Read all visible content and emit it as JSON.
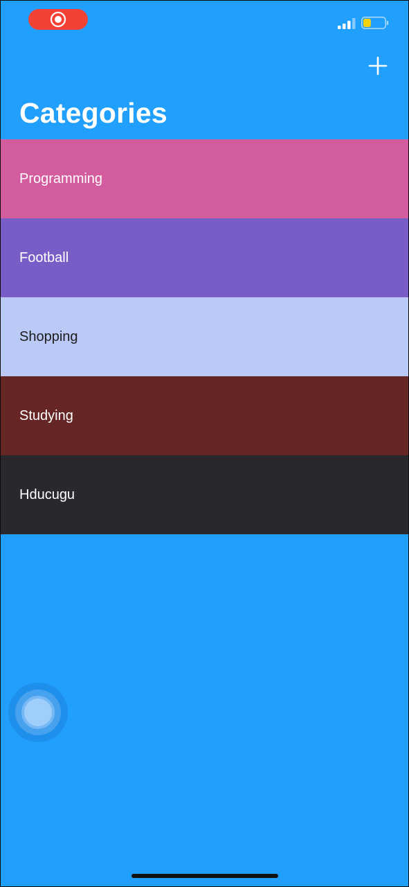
{
  "status_bar": {
    "recording_icon": "screen-recording-icon",
    "signal_icon": "cellular-signal-icon",
    "battery_icon": "battery-icon",
    "battery_level": 0.35,
    "recording_color": "#f24236",
    "battery_color": "#f5d20b"
  },
  "nav": {
    "title": "Categories",
    "add_icon": "plus-icon"
  },
  "categories": [
    {
      "label": "Programming",
      "color": "#d35c9f",
      "text_color": "#ffffff"
    },
    {
      "label": "Football",
      "color": "#785dc6",
      "text_color": "#ffffff"
    },
    {
      "label": "Shopping",
      "color": "#bac9f5",
      "text_color": "#1c1c1e"
    },
    {
      "label": "Studying",
      "color": "#652625",
      "text_color": "#ffffff"
    },
    {
      "label": "Hducugu",
      "color": "#29282c",
      "text_color": "#ffffff"
    }
  ],
  "background_color": "#209ffc",
  "assistive_touch_icon": "assistive-touch-icon"
}
